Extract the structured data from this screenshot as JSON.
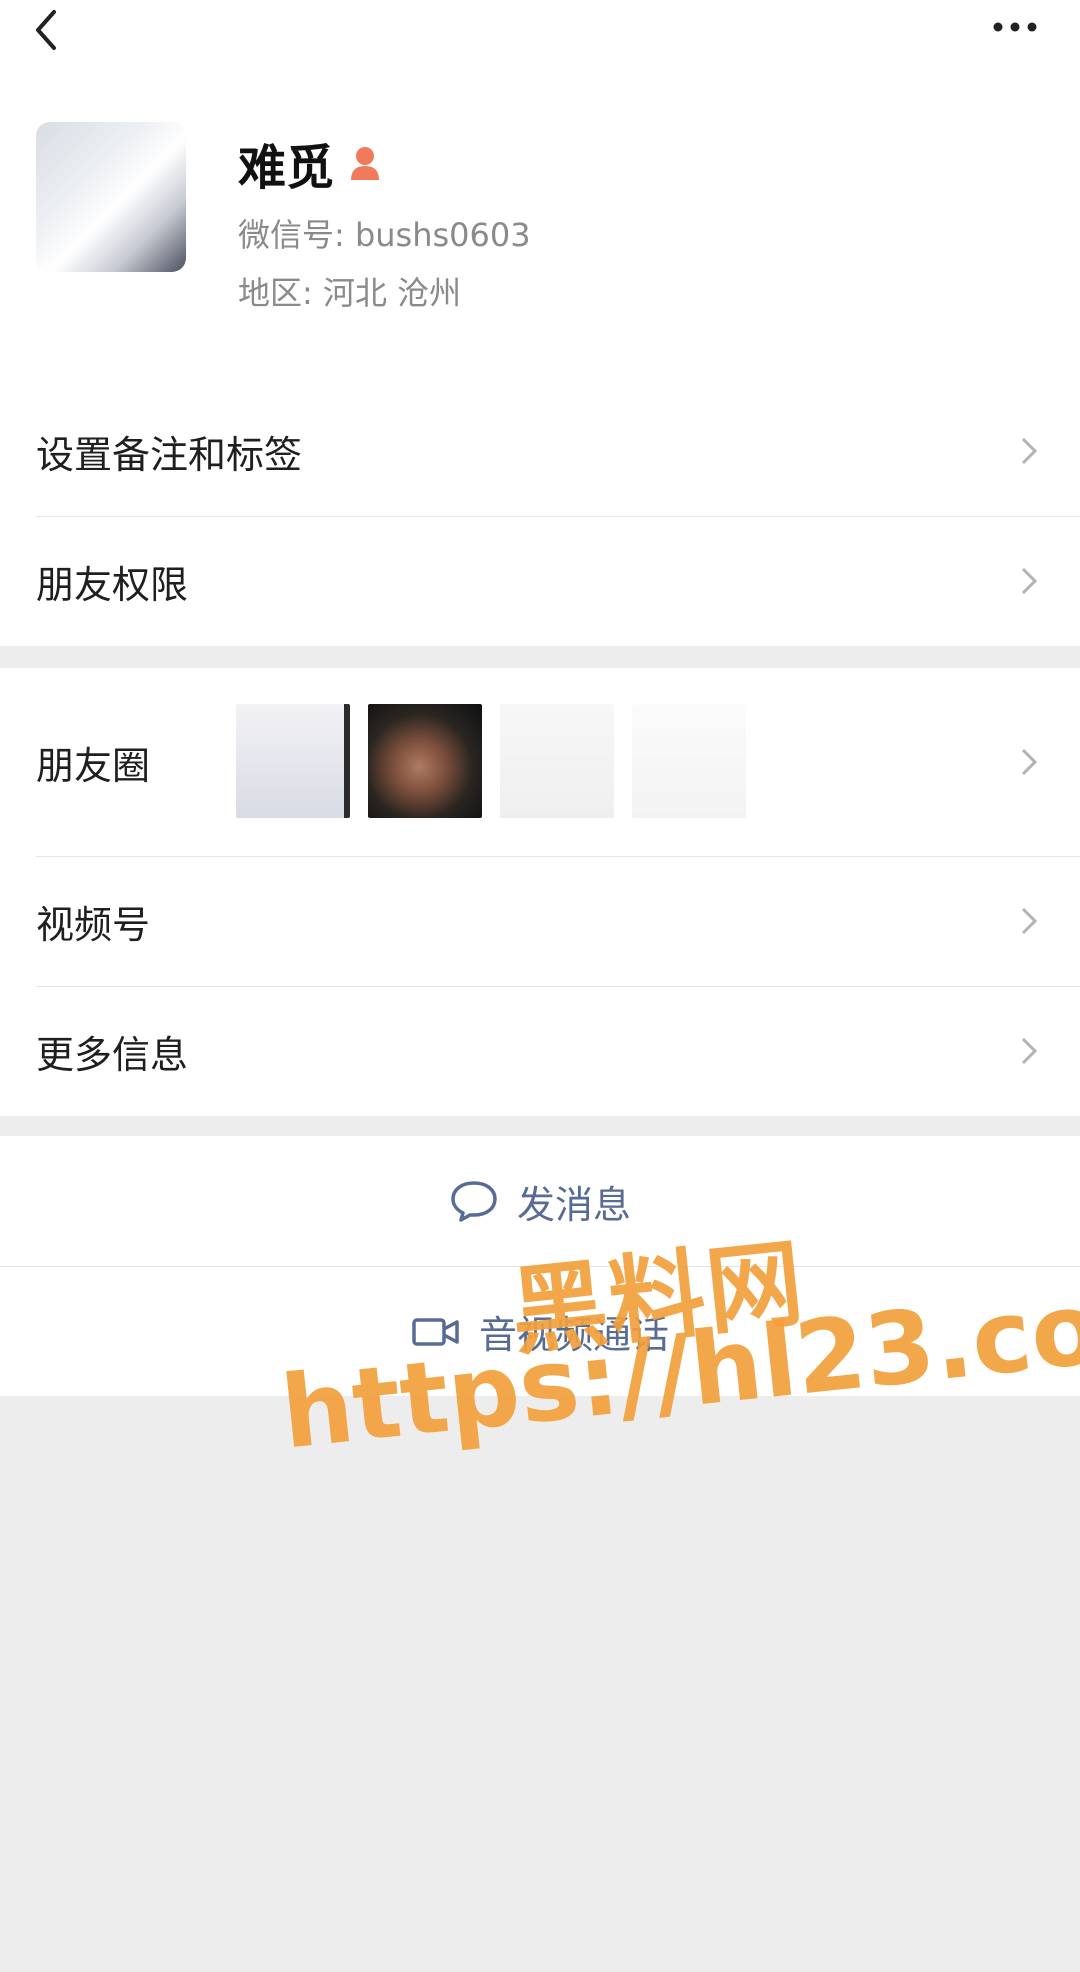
{
  "header": {
    "back_icon": "chevron-left-icon",
    "more_icon": "ellipsis-icon"
  },
  "profile": {
    "name": "难觅",
    "gender_icon": "female-person-icon",
    "wechat_id": "微信号: bushs0603",
    "region": "地区: 河北 沧州"
  },
  "menu": {
    "remark_tags": "设置备注和标签",
    "permissions": "朋友权限",
    "moments": "朋友圈",
    "channels": "视频号",
    "more_info": "更多信息"
  },
  "actions": {
    "message": "发消息",
    "message_icon": "chat-bubble-icon",
    "call": "音视频通话",
    "call_icon": "video-camera-icon"
  },
  "watermark": {
    "line1": "黑料网",
    "line2": "https://hl23.co"
  },
  "colors": {
    "link": "#576b95",
    "watermark": "#f3a03c",
    "gender_icon": "#f07a5a"
  }
}
